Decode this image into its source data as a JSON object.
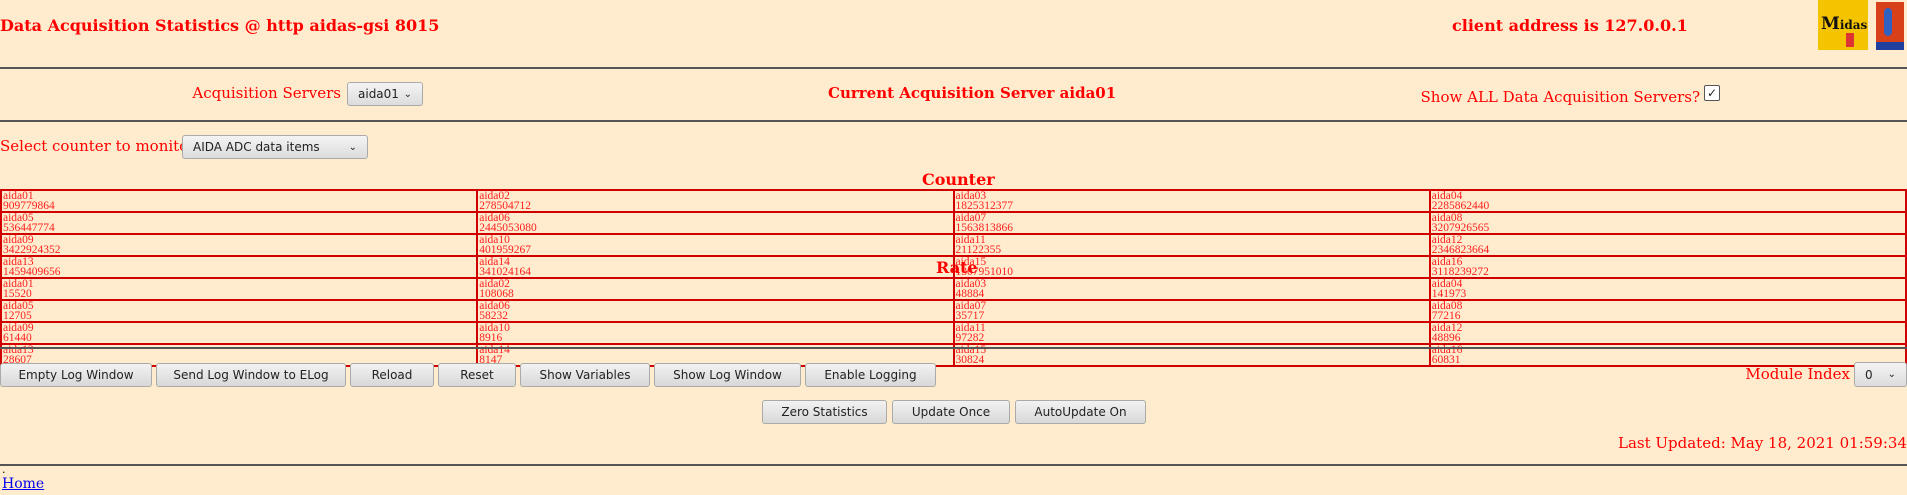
{
  "header": {
    "title": "Data Acquisition Statistics @ http aidas-gsi 8015",
    "client": "client address is 127.0.0.1",
    "logo_text": "Midas",
    "logo2_text": "TCL POWERED"
  },
  "servers": {
    "label": "Acquisition Servers",
    "selected": "aida01",
    "current": "Current Acquisition Server aida01",
    "show_all_label": "Show ALL Data Acquisition Servers?",
    "show_all_checked": true
  },
  "counter_select": {
    "label": "Select counter to monitor",
    "selected": "AIDA ADC data items"
  },
  "counter": {
    "title": "Counter",
    "rows": [
      [
        [
          "aida01",
          "909779864"
        ],
        [
          "aida02",
          "278504712"
        ],
        [
          "aida03",
          "1825312377"
        ],
        [
          "aida04",
          "2285862440"
        ]
      ],
      [
        [
          "aida05",
          "536447774"
        ],
        [
          "aida06",
          "2445053080"
        ],
        [
          "aida07",
          "1563813866"
        ],
        [
          "aida08",
          "3207926565"
        ]
      ],
      [
        [
          "aida09",
          "3422924352"
        ],
        [
          "aida10",
          "401959267"
        ],
        [
          "aida11",
          "21122355"
        ],
        [
          "aida12",
          "2346823664"
        ]
      ],
      [
        [
          "aida13",
          "1459409656"
        ],
        [
          "aida14",
          "341024164"
        ],
        [
          "aida15",
          "1307951010"
        ],
        [
          "aida16",
          "3118239272"
        ]
      ]
    ]
  },
  "rate": {
    "title": "Rate",
    "rows": [
      [
        [
          "aida01",
          "15520"
        ],
        [
          "aida02",
          "108068"
        ],
        [
          "aida03",
          "48884"
        ],
        [
          "aida04",
          "141973"
        ]
      ],
      [
        [
          "aida05",
          "12705"
        ],
        [
          "aida06",
          "58232"
        ],
        [
          "aida07",
          "35717"
        ],
        [
          "aida08",
          "77216"
        ]
      ],
      [
        [
          "aida09",
          "61440"
        ],
        [
          "aida10",
          "8916"
        ],
        [
          "aida11",
          "97282"
        ],
        [
          "aida12",
          "48896"
        ]
      ],
      [
        [
          "aida13",
          "28607"
        ],
        [
          "aida14",
          "8147"
        ],
        [
          "aida15",
          "30824"
        ],
        [
          "aida16",
          "60831"
        ]
      ]
    ]
  },
  "buttons": {
    "empty_log": "Empty Log Window",
    "send_log": "Send Log Window to ELog",
    "reload": "Reload",
    "reset": "Reset",
    "show_vars": "Show Variables",
    "show_log": "Show Log Window",
    "enable_logging": "Enable Logging",
    "zero_stats": "Zero Statistics",
    "update_once": "Update Once",
    "autoupdate": "AutoUpdate On"
  },
  "module": {
    "label": "Module Index",
    "selected": "0"
  },
  "last_updated": "Last Updated: May 18, 2021 01:59:34",
  "footer": {
    "dot": ".",
    "home": "Home"
  }
}
